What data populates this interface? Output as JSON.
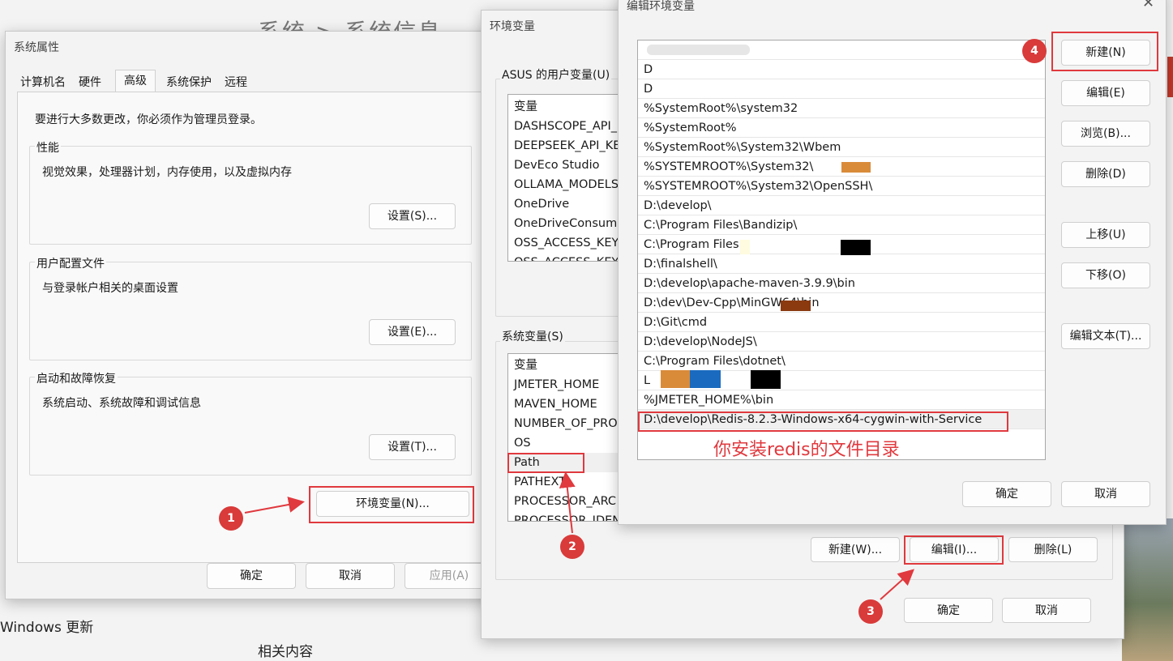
{
  "background": {
    "title": "系统 > 系统信息",
    "windows_update": "Windows 更新",
    "related": "相关内容"
  },
  "sysprops": {
    "title": "系统属性",
    "tabs": [
      "计算机名",
      "硬件",
      "高级",
      "系统保护",
      "远程"
    ],
    "active_tab": "高级",
    "admin_note": "要进行大多数更改，你必须作为管理员登录。",
    "perf_label": "性能",
    "perf_desc": "视觉效果，处理器计划，内存使用，以及虚拟内存",
    "perf_btn": "设置(S)...",
    "profile_label": "用户配置文件",
    "profile_desc": "与登录帐户相关的桌面设置",
    "profile_btn": "设置(E)...",
    "startup_label": "启动和故障恢复",
    "startup_desc": "系统启动、系统故障和调试信息",
    "startup_btn": "设置(T)...",
    "env_btn": "环境变量(N)...",
    "ok": "确定",
    "cancel": "取消",
    "apply": "应用(A)"
  },
  "envvars": {
    "title": "环境变量",
    "user_section": "ASUS 的用户变量(U)",
    "user_header": "变量",
    "user_vars": [
      "DASHSCOPE_API_",
      "DEEPSEEK_API_KEY",
      "DevEco Studio",
      "OLLAMA_MODELS",
      "OneDrive",
      "OneDriveConsume",
      "OSS_ACCESS_KEY",
      "OSS_ACCESS_KEY"
    ],
    "sys_section": "系统变量(S)",
    "sys_header": "变量",
    "sys_vars": [
      "JMETER_HOME",
      "MAVEN_HOME",
      "NUMBER_OF_PRO",
      "OS",
      "Path",
      "PATHEXT",
      "PROCESSOR_ARC",
      "PROCESSOR_IDEN"
    ],
    "new_btn": "新建(W)...",
    "edit_btn": "编辑(I)...",
    "delete_btn": "删除(L)",
    "ok": "确定",
    "cancel": "取消"
  },
  "editenv": {
    "title": "编辑环境变量",
    "paths": [
      "",
      "D",
      "D",
      "%SystemRoot%\\system32",
      "%SystemRoot%",
      "%SystemRoot%\\System32\\Wbem",
      "%SYSTEMROOT%\\System32\\",
      "%SYSTEMROOT%\\System32\\OpenSSH\\",
      "D:\\develop\\",
      "C:\\Program Files\\Bandizip\\",
      "C:\\Program Files",
      "D:\\finalshell\\",
      "D:\\develop\\apache-maven-3.9.9\\bin",
      "D:\\dev\\Dev-Cpp\\MinGW64\\bin",
      "D:\\Git\\cmd",
      "D:\\develop\\NodeJS\\",
      "C:\\Program Files\\dotnet\\",
      "L",
      "%JMETER_HOME%\\bin",
      "D:\\develop\\Redis-8.2.3-Windows-x64-cygwin-with-Service"
    ],
    "new_btn": "新建(N)",
    "edit_btn": "编辑(E)",
    "browse_btn": "浏览(B)...",
    "delete_btn": "删除(D)",
    "up_btn": "上移(U)",
    "down_btn": "下移(O)",
    "edit_text_btn": "编辑文本(T)...",
    "ok": "确定",
    "cancel": "取消",
    "note": "你安装redis的文件目录"
  },
  "badges": [
    "1",
    "2",
    "3",
    "4"
  ],
  "colors": {
    "annotation_red": "#e0393e",
    "badge_red": "#d93a3a",
    "redact_orange": "#d98b3a",
    "redact_blue": "#1a6bbf",
    "redact_black": "#000000",
    "redact_brown": "#8b3a10"
  }
}
